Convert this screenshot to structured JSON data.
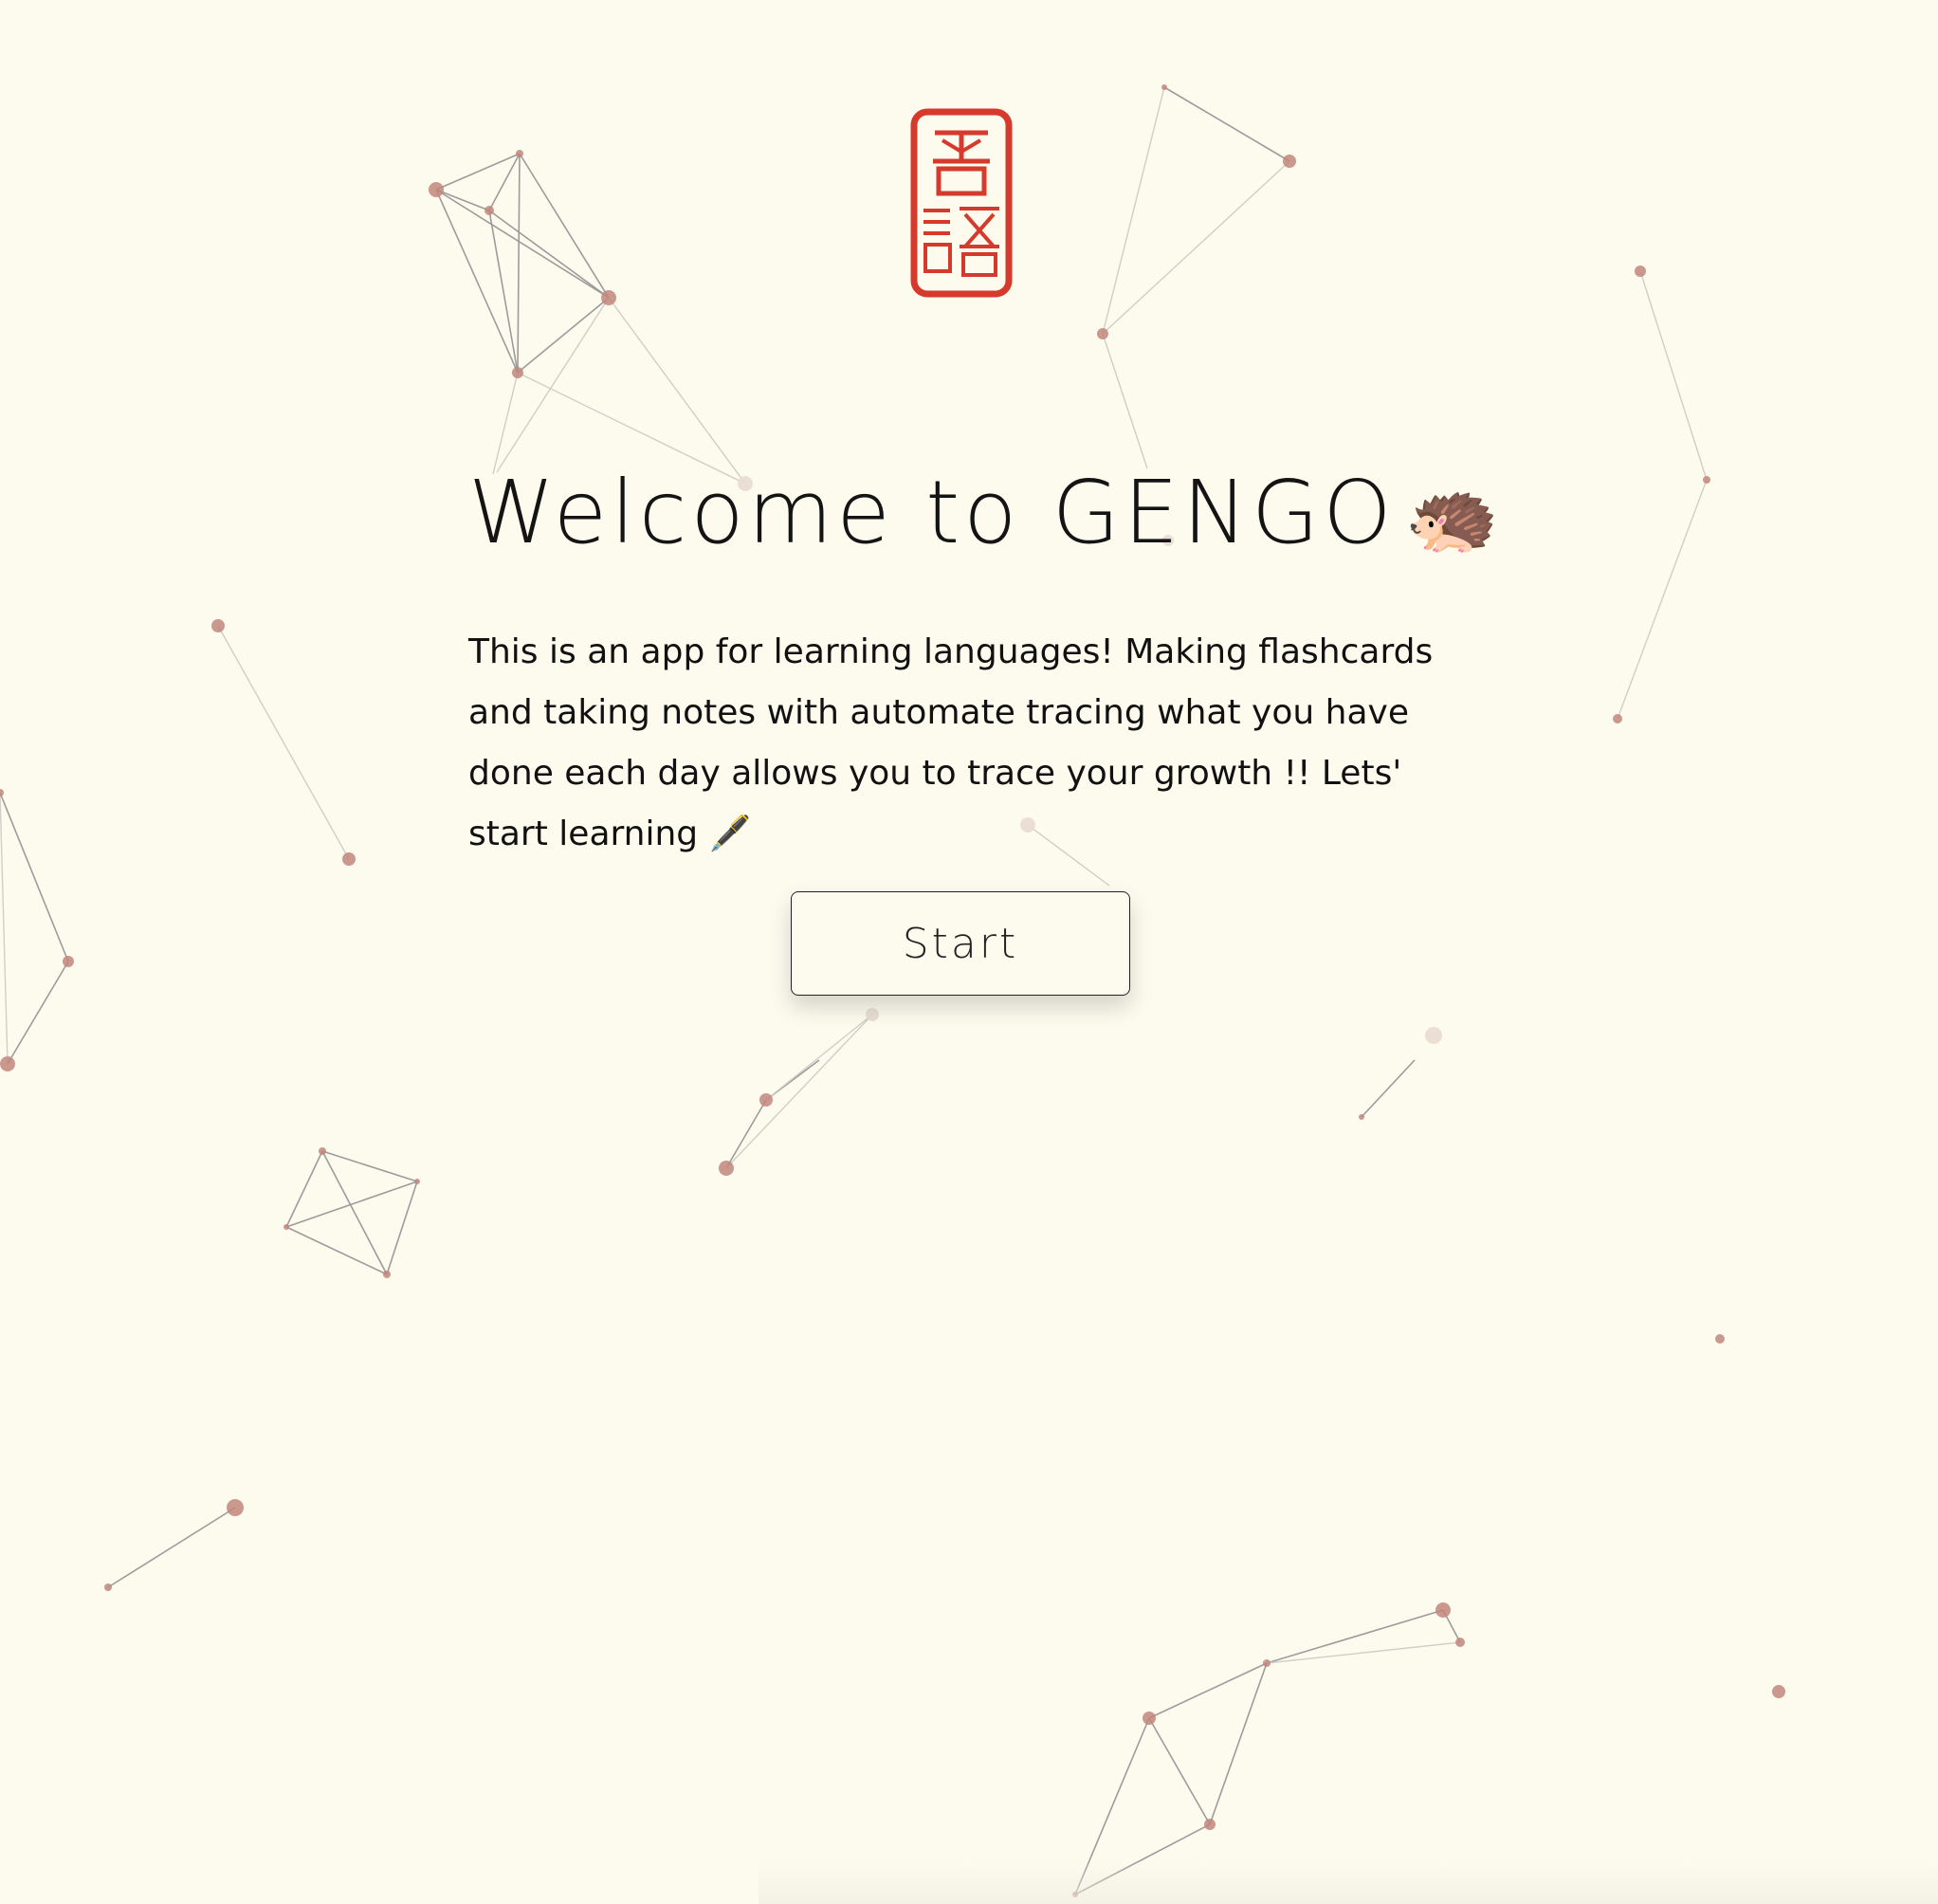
{
  "page": {
    "background_color": "#fdfbee",
    "accent_color": "#d63a2c",
    "node_color": "#c2867c"
  },
  "hero": {
    "title": "Welcome to GENGO",
    "title_emoji": "🦔",
    "description": "This is an app for learning languages! Making flashcards and taking notes with automate tracing what you have done each day allows you to trace your growth !! Lets' start learning 🖋️",
    "start_label": "Start"
  },
  "icons": {
    "logo": "gengo-seal-logo",
    "title_icon": "hedgehog-icon"
  }
}
